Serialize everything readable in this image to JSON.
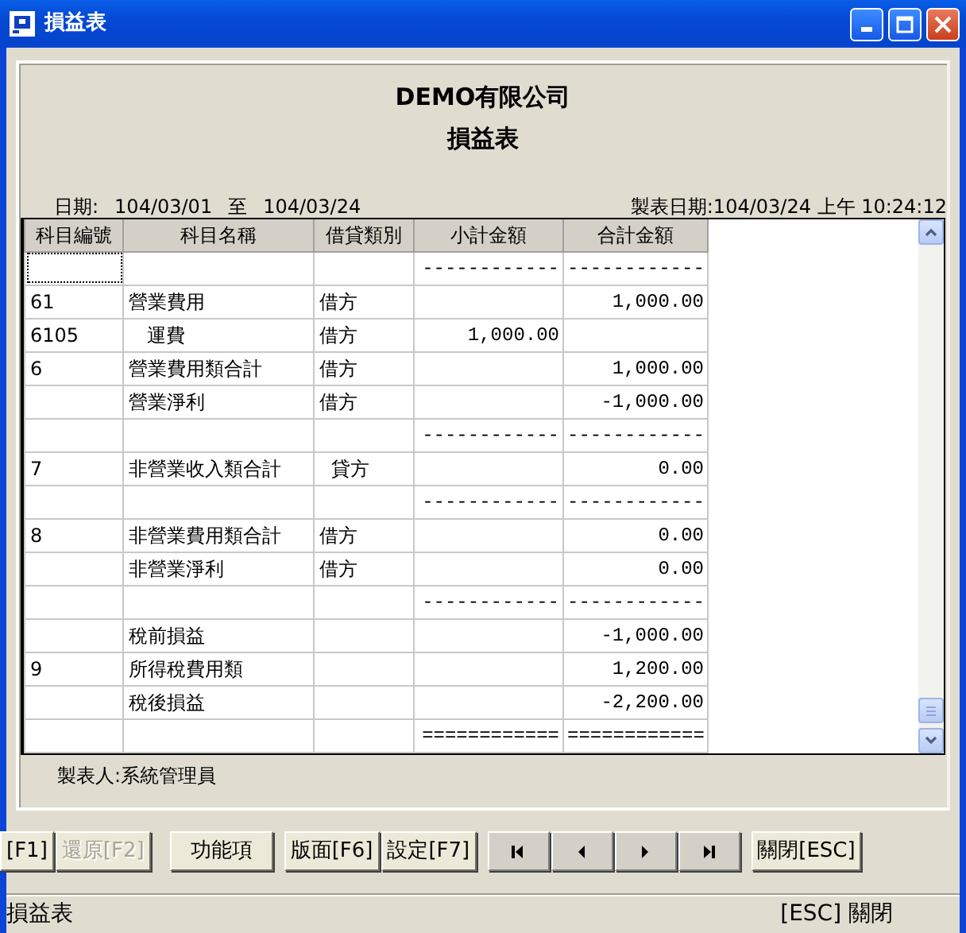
{
  "window": {
    "title": "損益表"
  },
  "report": {
    "company": "DEMO有限公司",
    "title": "損益表",
    "period_label": "日期:",
    "period_from": "104/03/01",
    "period_sep": "至",
    "period_to": "104/03/24",
    "printed": "製表日期:104/03/24 上午 10:24:12",
    "preparer": "製表人:系統管理員"
  },
  "table": {
    "columns": [
      "科目編號",
      "科目名稱",
      "借貸類別",
      "小計金額",
      "合計金額"
    ],
    "rows": [
      {
        "cells": [
          "",
          "",
          "",
          "------------",
          "------------"
        ],
        "focused": true
      },
      {
        "cells": [
          "61",
          "營業費用",
          "借方",
          "",
          "1,000.00"
        ],
        "focused": false
      },
      {
        "cells": [
          "6105",
          "   運費",
          "借方",
          "1,000.00",
          ""
        ],
        "focused": false
      },
      {
        "cells": [
          "6",
          "營業費用類合計",
          "借方",
          "",
          "1,000.00"
        ],
        "focused": false
      },
      {
        "cells": [
          "",
          "營業淨利",
          "借方",
          "",
          "-1,000.00"
        ],
        "focused": false
      },
      {
        "cells": [
          "",
          "",
          "",
          "------------",
          "------------"
        ],
        "focused": false
      },
      {
        "cells": [
          "7",
          "非營業收入類合計",
          "  貸方",
          "",
          "0.00"
        ],
        "focused": false
      },
      {
        "cells": [
          "",
          "",
          "",
          "------------",
          "------------"
        ],
        "focused": false
      },
      {
        "cells": [
          "8",
          "非營業費用類合計",
          "借方",
          "",
          "0.00"
        ],
        "focused": false
      },
      {
        "cells": [
          "",
          "非營業淨利",
          "借方",
          "",
          "0.00"
        ],
        "focused": false
      },
      {
        "cells": [
          "",
          "",
          "",
          "------------",
          "------------"
        ],
        "focused": false
      },
      {
        "cells": [
          "",
          "稅前損益",
          "",
          "",
          "-1,000.00"
        ],
        "focused": false
      },
      {
        "cells": [
          "9",
          "所得稅費用類",
          "",
          "",
          "1,200.00"
        ],
        "focused": false
      },
      {
        "cells": [
          "",
          "稅後損益",
          "",
          "",
          "-2,200.00"
        ],
        "focused": false
      },
      {
        "cells": [
          "",
          "",
          "",
          "============",
          "============"
        ],
        "focused": false
      }
    ]
  },
  "button_groups": [
    [
      {
        "kind": "text",
        "label": "[F1]",
        "disabled": false
      },
      {
        "kind": "text",
        "label": "還原[F2]",
        "disabled": true
      }
    ],
    [
      {
        "kind": "text",
        "label": "功能項",
        "disabled": false
      }
    ],
    [
      {
        "kind": "text",
        "label": "版面[F6]",
        "disabled": false
      },
      {
        "kind": "text",
        "label": "設定[F7]",
        "disabled": false
      }
    ],
    [
      {
        "kind": "first",
        "disabled": false
      },
      {
        "kind": "prev",
        "disabled": false
      },
      {
        "kind": "next",
        "disabled": false
      },
      {
        "kind": "last",
        "disabled": false
      }
    ],
    [
      {
        "kind": "text",
        "label": "關閉[ESC]",
        "disabled": false
      }
    ]
  ],
  "status_bar": {
    "left": "損益表",
    "right": "[ESC] 關閉"
  }
}
